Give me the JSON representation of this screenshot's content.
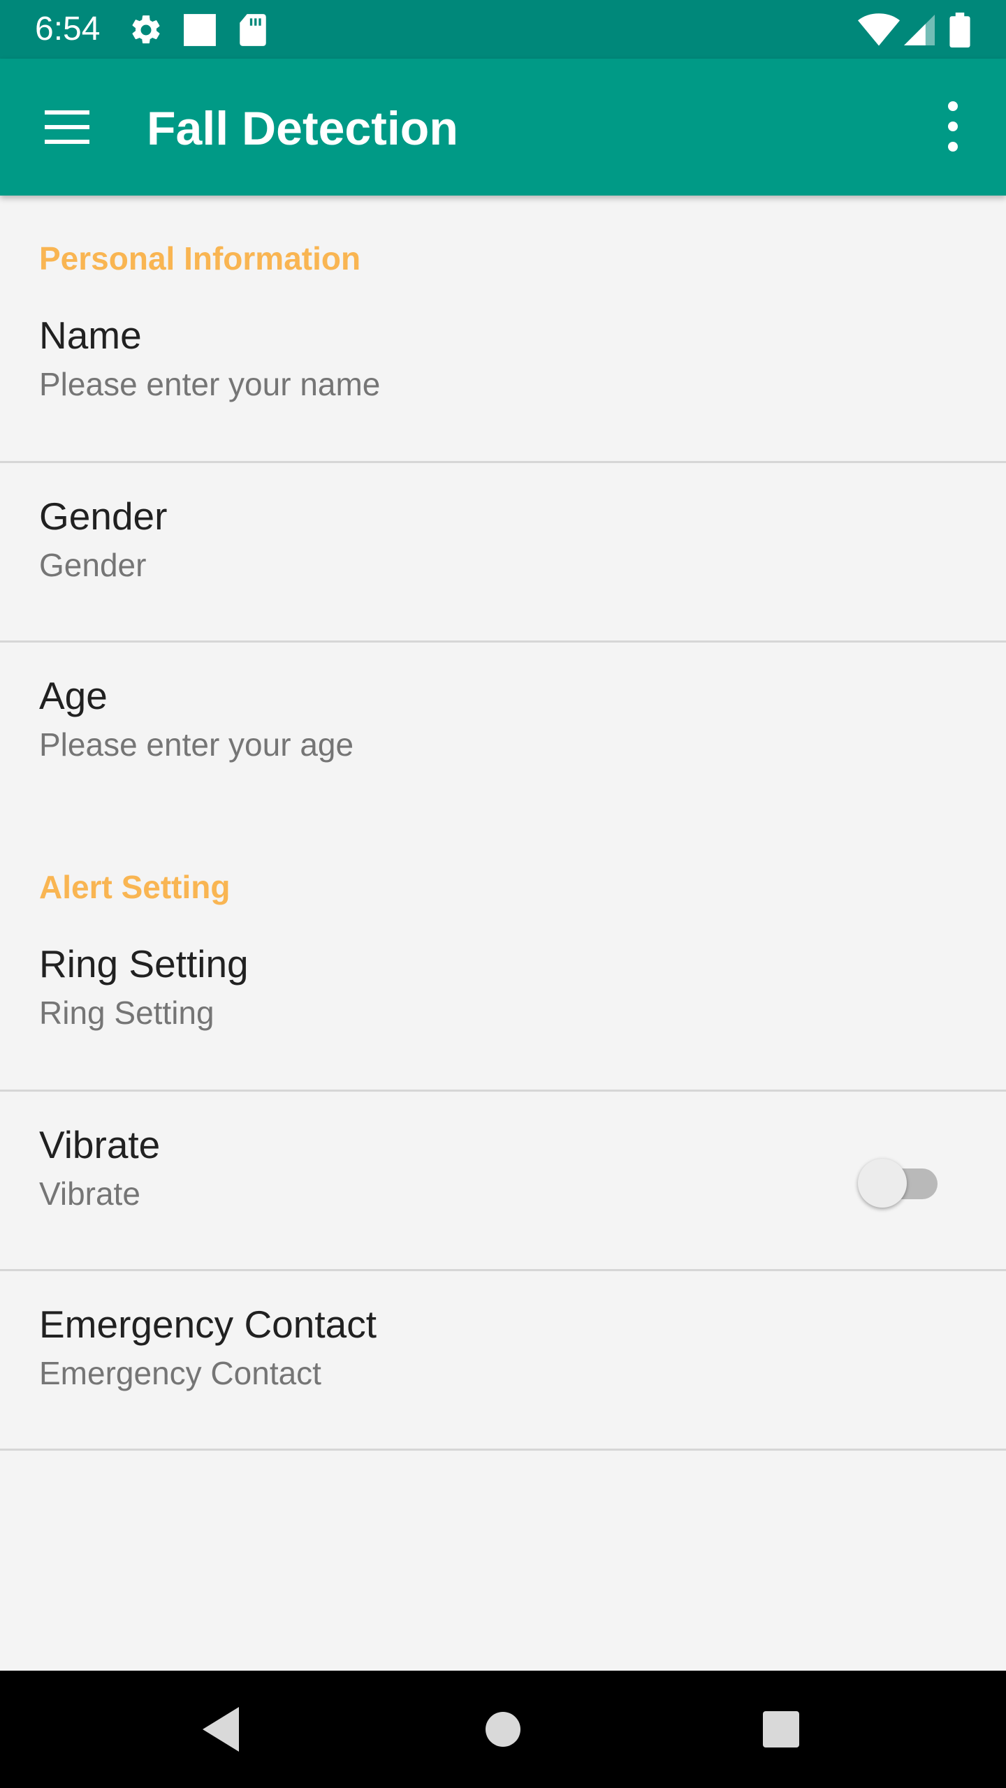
{
  "status_bar": {
    "time": "6:54",
    "left_icons": [
      "gear-icon",
      "square-notification-icon",
      "sd-card-icon"
    ],
    "right_icons": [
      "wifi-icon",
      "cell-signal-icon",
      "battery-icon"
    ]
  },
  "app_bar": {
    "title": "Fall Detection",
    "menu_icon": "hamburger-menu-icon",
    "overflow_icon": "more-vert-icon"
  },
  "sections": [
    {
      "header": "Personal Information",
      "items": [
        {
          "title": "Name",
          "summary": "Please enter your name"
        },
        {
          "title": "Gender",
          "summary": "Gender"
        },
        {
          "title": "Age",
          "summary": "Please enter your age"
        }
      ]
    },
    {
      "header": "Alert Setting",
      "items": [
        {
          "title": "Ring Setting",
          "summary": "Ring Setting"
        },
        {
          "title": "Vibrate",
          "summary": "Vibrate",
          "switch_on": false
        },
        {
          "title": "Emergency Contact",
          "summary": "Emergency Contact"
        }
      ]
    }
  ],
  "nav_bar": {
    "icons": [
      "back-icon",
      "home-icon",
      "recents-icon"
    ]
  },
  "colors": {
    "status_bar": "#00887a",
    "app_bar": "#009a86",
    "accent": "#f9b552",
    "background": "#f4f4f4"
  }
}
